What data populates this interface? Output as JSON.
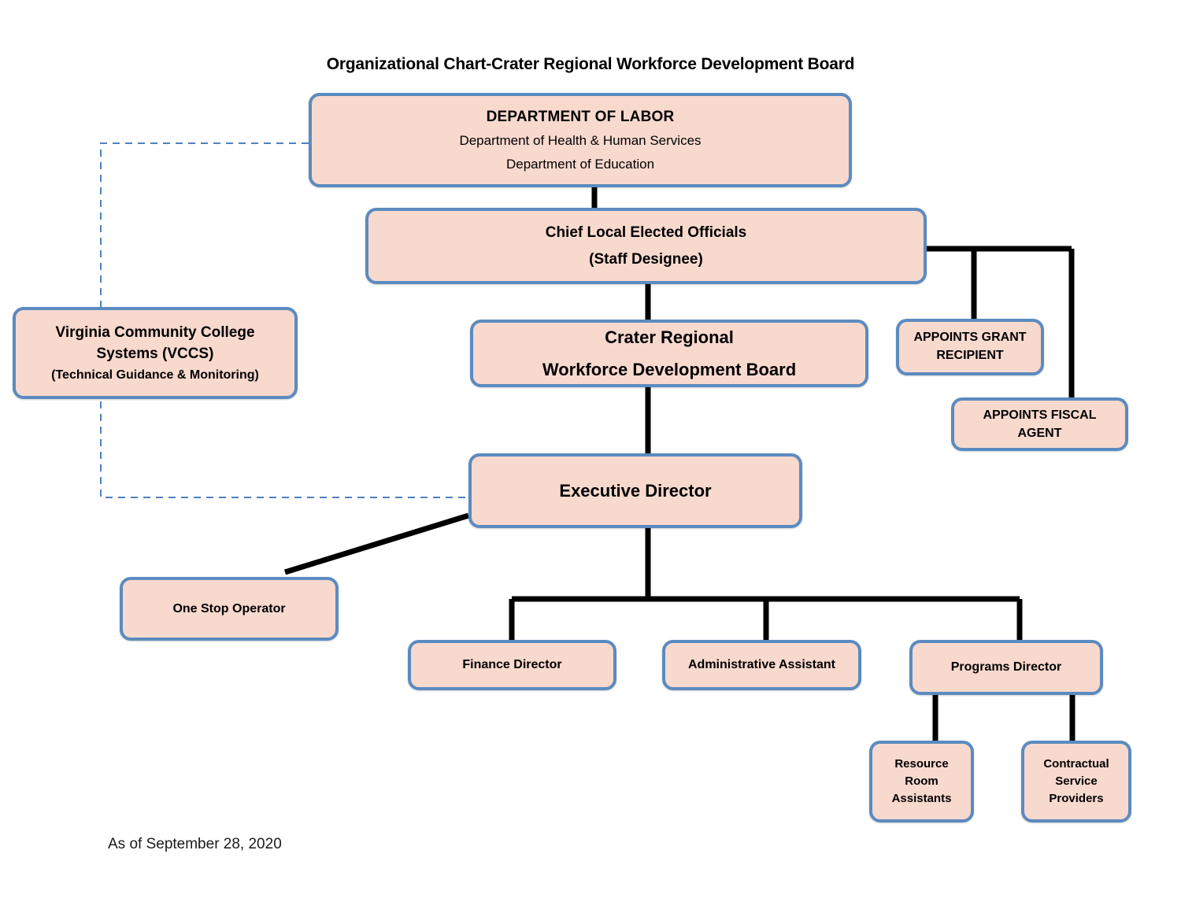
{
  "title": "Organizational Chart-Crater Regional Workforce Development Board",
  "footer": {
    "date": "As of September 28, 2020"
  },
  "colors": {
    "box_fill": "#F8D9CE",
    "box_border": "#5B8BC0",
    "connector": "#000000",
    "dashed_connector": "#4F81BD",
    "text": "#000000",
    "page_background": "#FFFFFF"
  },
  "nodes": {
    "dol": {
      "id": "department-of-labor",
      "lines": [
        "DEPARTMENT OF LABOR",
        "Department of Health & Human Services",
        "Department of Education"
      ]
    },
    "cleo": {
      "id": "chief-local-elected-officials",
      "lines": [
        "Chief Local Elected Officials",
        "(Staff Designee)"
      ]
    },
    "vccs": {
      "id": "virginia-community-college-systems",
      "lines": [
        "Virginia Community College",
        "Systems  (VCCS)",
        "(Technical Guidance & Monitoring)"
      ]
    },
    "crwdb": {
      "id": "crater-regional-workforce-development-board",
      "lines": [
        "Crater Regional",
        "Workforce Development Board"
      ]
    },
    "grant_recipient": {
      "id": "appoints-grant-recipient",
      "lines": [
        "APPOINTS GRANT",
        "RECIPIENT",
        ""
      ]
    },
    "fiscal_agent": {
      "id": "appoints-fiscal-agent",
      "lines": [
        "APPOINTS FISCAL",
        "AGENT"
      ]
    },
    "executive_director": {
      "id": "executive-director",
      "lines": [
        "Executive Director"
      ]
    },
    "one_stop_operator": {
      "id": "one-stop-operator",
      "lines": [
        "One Stop Operator"
      ]
    },
    "finance_director": {
      "id": "finance-director",
      "lines": [
        "Finance Director"
      ]
    },
    "administrative_assistant": {
      "id": "administrative-assistant",
      "lines": [
        "Administrative Assistant"
      ]
    },
    "programs_director": {
      "id": "programs-director",
      "lines": [
        "Programs Director"
      ]
    },
    "resource_room_assistants": {
      "id": "resource-room-assistants",
      "lines": [
        "Resource",
        "Room",
        "Assistants"
      ]
    },
    "contractual_service_providers": {
      "id": "contractual-service-providers",
      "lines": [
        "Contractual",
        "Service",
        "Providers"
      ]
    }
  }
}
